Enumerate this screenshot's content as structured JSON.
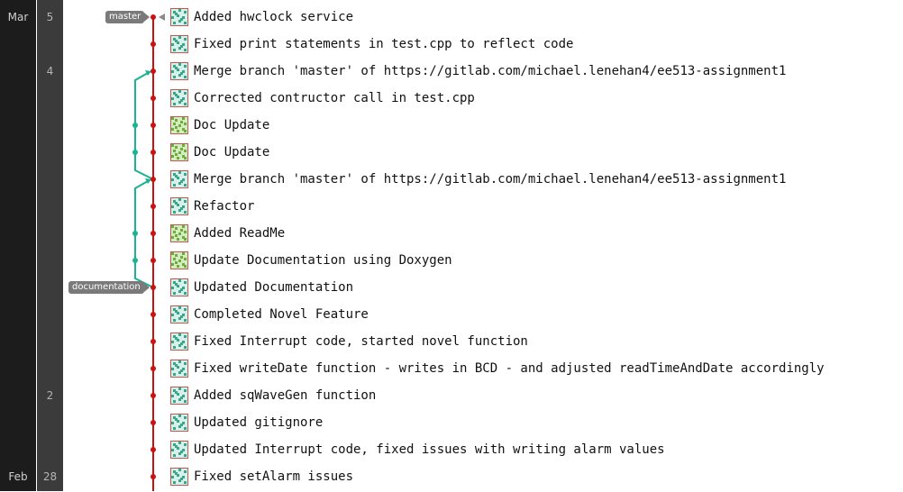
{
  "timeline": {
    "months": [
      {
        "label": "Mar",
        "row": 0
      },
      {
        "label": "Feb",
        "row": 17
      }
    ],
    "days": [
      {
        "label": "5",
        "row": 0
      },
      {
        "label": "4",
        "row": 2
      },
      {
        "label": "2",
        "row": 14
      },
      {
        "label": "28",
        "row": 17
      }
    ]
  },
  "refs": [
    {
      "label": "master",
      "row": 0
    },
    {
      "label": "documentation",
      "row": 10
    }
  ],
  "commits": [
    {
      "message": "Added hwclock service",
      "author": "a"
    },
    {
      "message": "Fixed print statements in test.cpp to reflect code",
      "author": "a"
    },
    {
      "message": "Merge branch 'master' of https://gitlab.com/michael.lenehan4/ee513-assignment1",
      "author": "a"
    },
    {
      "message": "Corrected contructor call in test.cpp",
      "author": "a"
    },
    {
      "message": "Doc Update",
      "author": "b"
    },
    {
      "message": "Doc Update",
      "author": "b"
    },
    {
      "message": "Merge branch 'master' of https://gitlab.com/michael.lenehan4/ee513-assignment1",
      "author": "a"
    },
    {
      "message": "Refactor",
      "author": "a"
    },
    {
      "message": "Added ReadMe",
      "author": "b"
    },
    {
      "message": "Update Documentation using Doxygen",
      "author": "b"
    },
    {
      "message": "Updated Documentation",
      "author": "a"
    },
    {
      "message": "Completed Novel Feature",
      "author": "a"
    },
    {
      "message": "Fixed Interrupt code, started novel function",
      "author": "a"
    },
    {
      "message": "Fixed writeDate function - writes in BCD - and adjusted readTimeAndDate accordingly",
      "author": "a"
    },
    {
      "message": "Added sqWaveGen function",
      "author": "a"
    },
    {
      "message": "Updated gitignore",
      "author": "a"
    },
    {
      "message": "Updated Interrupt code, fixed issues with writing alarm values",
      "author": "a"
    },
    {
      "message": "Fixed setAlarm issues",
      "author": "a"
    }
  ],
  "colors": {
    "main_branch": "#cc1111",
    "side_branch": "#1ab394",
    "avatar_a_bg": "#d7f0ea",
    "avatar_a_fg": "#3aa58c",
    "avatar_b_bg": "#d6ecc0",
    "avatar_b_fg": "#6cae3c"
  }
}
